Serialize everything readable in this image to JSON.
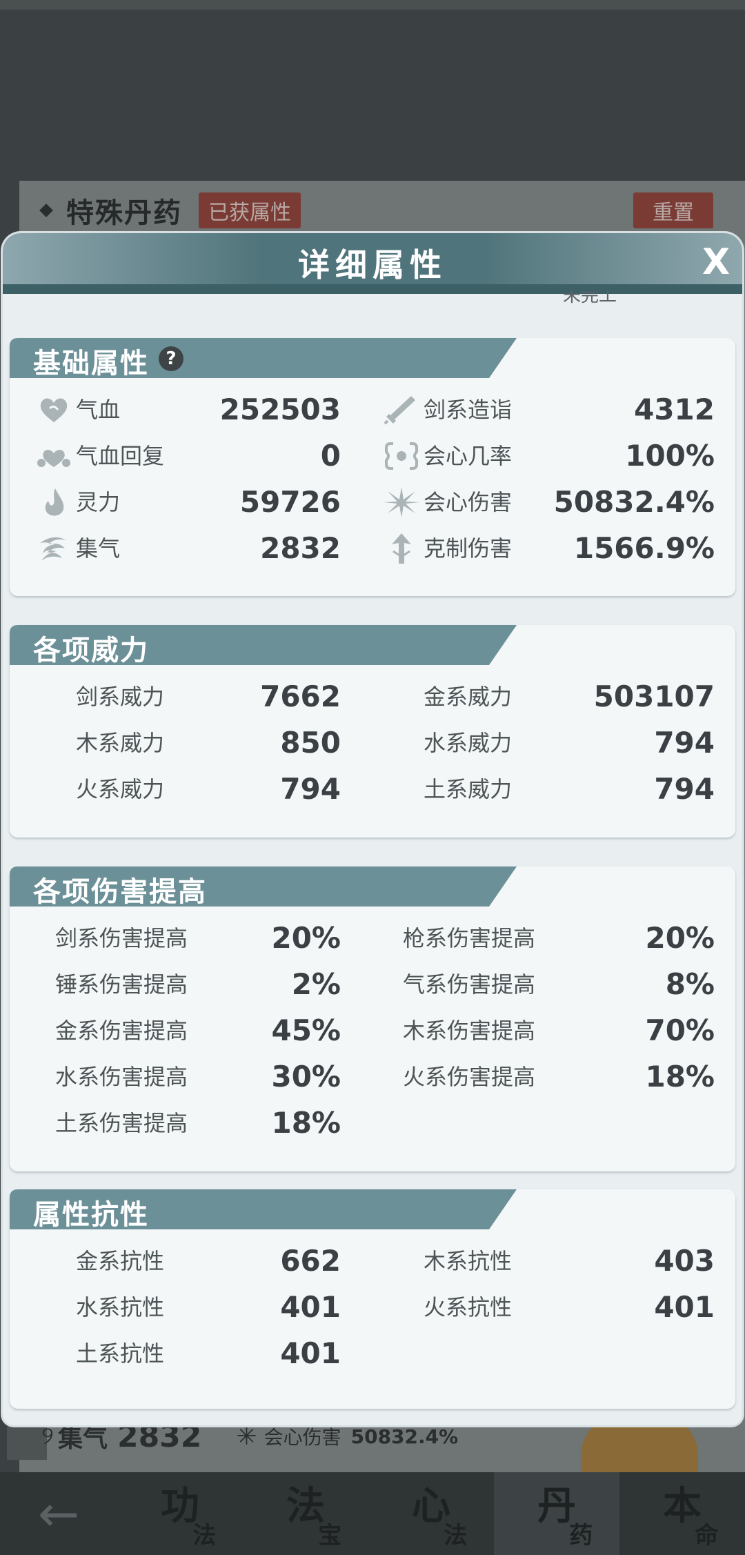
{
  "background": {
    "panel_title": "特殊丹药",
    "tag": "已获属性",
    "reset_button": "重置",
    "under_row": {
      "label1": "集气",
      "value1": "2832",
      "label2": "会心伤害",
      "value2": "50832.4%"
    },
    "cutoff_text": "未完工",
    "bottom_nav": {
      "back": "←",
      "tabs": [
        {
          "big": "功",
          "small": "法"
        },
        {
          "big": "法",
          "small": "宝"
        },
        {
          "big": "心",
          "small": "法"
        },
        {
          "big": "丹",
          "small": "药"
        },
        {
          "big": "本",
          "small": "命"
        }
      ]
    }
  },
  "modal": {
    "title": "详细属性",
    "close": "X"
  },
  "colors": {
    "header_teal": "#50747b",
    "section_banner": "#6c9097",
    "panel_bg": "#f4f7f8",
    "value_text": "#3a4043",
    "label_text": "#4d5456"
  },
  "sections": {
    "basic": {
      "title": "基础属性",
      "help": "?",
      "left": [
        {
          "icon": "heart-icon",
          "label": "气血",
          "value": "252503"
        },
        {
          "icon": "heart-regen-icon",
          "label": "气血回复",
          "value": "0"
        },
        {
          "icon": "flame-drop-icon",
          "label": "灵力",
          "value": "59726"
        },
        {
          "icon": "swirl-icon",
          "label": "集气",
          "value": "2832"
        }
      ],
      "right": [
        {
          "icon": "sword-icon",
          "label": "剑系造诣",
          "value": "4312"
        },
        {
          "icon": "critical-rate-icon",
          "label": "会心几率",
          "value": "100%"
        },
        {
          "icon": "burst-icon",
          "label": "会心伤害",
          "value": "50832.4%"
        },
        {
          "icon": "arrow-up-icon",
          "label": "克制伤害",
          "value": "1566.9%"
        }
      ]
    },
    "power": {
      "title": "各项威力",
      "left": [
        {
          "label": "剑系威力",
          "value": "7662"
        },
        {
          "label": "木系威力",
          "value": "850"
        },
        {
          "label": "火系威力",
          "value": "794"
        }
      ],
      "right": [
        {
          "label": "金系威力",
          "value": "503107"
        },
        {
          "label": "水系威力",
          "value": "794"
        },
        {
          "label": "土系威力",
          "value": "794"
        }
      ]
    },
    "damage": {
      "title": "各项伤害提高",
      "left": [
        {
          "label": "剑系伤害提高",
          "value": "20%"
        },
        {
          "label": "锤系伤害提高",
          "value": "2%"
        },
        {
          "label": "金系伤害提高",
          "value": "45%"
        },
        {
          "label": "水系伤害提高",
          "value": "30%"
        },
        {
          "label": "土系伤害提高",
          "value": "18%"
        }
      ],
      "right": [
        {
          "label": "枪系伤害提高",
          "value": "20%"
        },
        {
          "label": "气系伤害提高",
          "value": "8%"
        },
        {
          "label": "木系伤害提高",
          "value": "70%"
        },
        {
          "label": "火系伤害提高",
          "value": "18%"
        }
      ]
    },
    "resist": {
      "title": "属性抗性",
      "left": [
        {
          "label": "金系抗性",
          "value": "662"
        },
        {
          "label": "水系抗性",
          "value": "401"
        },
        {
          "label": "土系抗性",
          "value": "401"
        }
      ],
      "right": [
        {
          "label": "木系抗性",
          "value": "403"
        },
        {
          "label": "火系抗性",
          "value": "401"
        }
      ]
    }
  }
}
